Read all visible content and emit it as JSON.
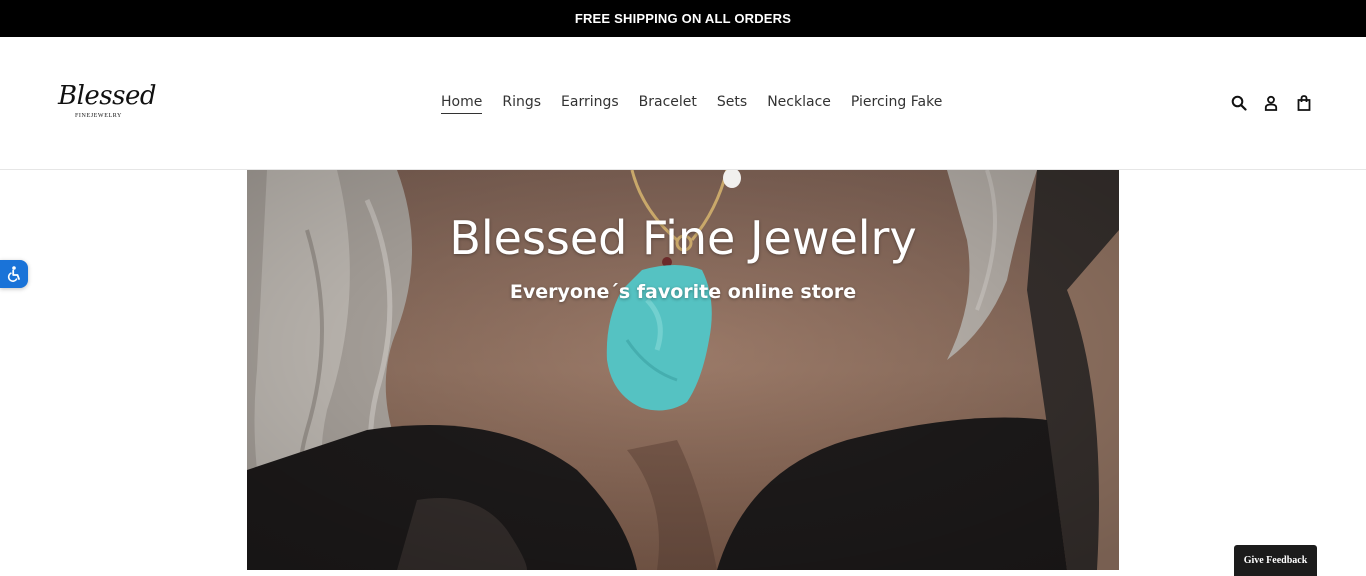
{
  "announcement": {
    "text": "FREE SHIPPING ON ALL ORDERS"
  },
  "brand": {
    "name": "Blessed",
    "tagline": "FINEJEWELRY"
  },
  "nav": {
    "items": [
      {
        "label": "Home",
        "active": true
      },
      {
        "label": "Rings",
        "active": false
      },
      {
        "label": "Earrings",
        "active": false
      },
      {
        "label": "Bracelet",
        "active": false
      },
      {
        "label": "Sets",
        "active": false
      },
      {
        "label": "Necklace",
        "active": false
      },
      {
        "label": "Piercing Fake",
        "active": false
      }
    ]
  },
  "header_icons": [
    "search-icon",
    "account-icon",
    "cart-icon"
  ],
  "hero": {
    "title": "Blessed Fine Jewelry",
    "subtitle": "Everyone´s favorite online store"
  },
  "accessibility": {
    "icon": "accessibility-icon",
    "color": "#1a73d8"
  },
  "feedback": {
    "label": "Give Feedback"
  }
}
